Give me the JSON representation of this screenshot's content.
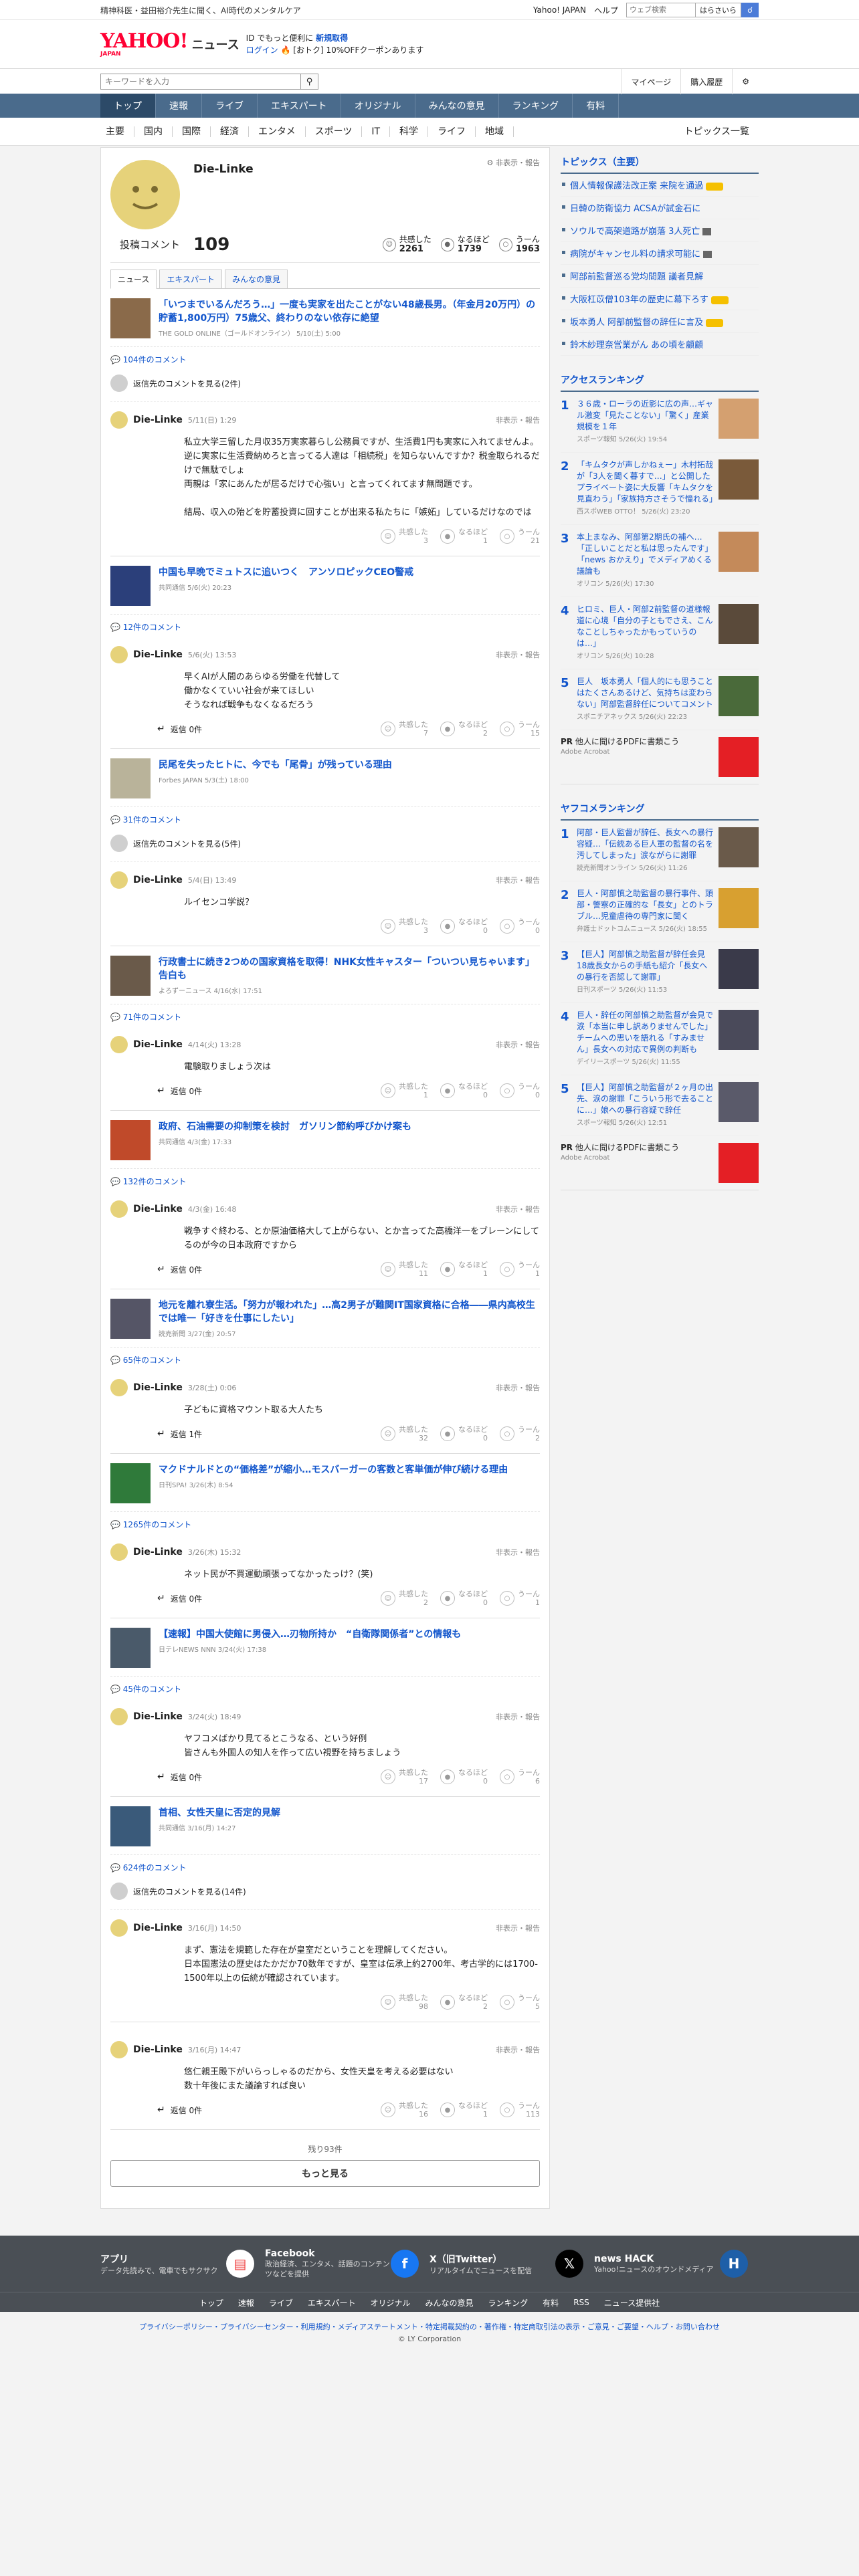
{
  "top": {
    "promo": "精神科医・益田裕介先生に聞く、AI時代のメンタルケア",
    "links": [
      "Yahoo! JAPAN",
      "ヘルプ"
    ],
    "search_placeholder": "ウェブ検索",
    "search_btn": "はらさいら"
  },
  "header": {
    "logo": "YAHOO!",
    "logo_sub": "JAPAN",
    "section": "ニュース",
    "msg1": "ID でもっと便利に",
    "msg1b": "新規取得",
    "login": "ログイン",
    "msg2": "[おトク] 10%OFFクーポンあります"
  },
  "bar2": {
    "kw_placeholder": "キーワードを入力",
    "mypage": "マイページ",
    "history": "購入履歴"
  },
  "gnav": [
    "トップ",
    "速報",
    "ライブ",
    "エキスパート",
    "オリジナル",
    "みんなの意見",
    "ランキング",
    "有料"
  ],
  "snav": [
    "主要",
    "国内",
    "国際",
    "経済",
    "エンタメ",
    "スポーツ",
    "IT",
    "科学",
    "ライフ",
    "地域"
  ],
  "snav_all": "トピックス一覧",
  "profile": {
    "name": "Die-Linke",
    "report": "非表示・報告",
    "label": "投稿コメント",
    "count": "109",
    "rx": [
      {
        "l": "共感した",
        "v": "2261"
      },
      {
        "l": "なるほど",
        "v": "1739"
      },
      {
        "l": "うーん",
        "v": "1963"
      }
    ]
  },
  "tabs": [
    "ニュース",
    "エキスパート",
    "みんなの意見"
  ],
  "items": [
    {
      "title": "「いつまでいるんだろう…」一度も実家を出たことがない48歳長男。（年金月20万円）の貯蓄1,800万円）75歳父、終わりのない依存に絶望",
      "src": "THE GOLD ONLINE（ゴールドオンライン） 5/10(土) 5:00",
      "cc": "104件のコメント",
      "parent": "返信先のコメントを見る(2件)",
      "date": "5/11(日) 1:29",
      "body": "私立大学三留した月収35万実家暮らし公務員ですが、生活費1円も実家に入れてませんよ。\n逆に実家に生活費納めろと言ってる人達は「相続税」を知らないんですか？税金取られるだけで無駄でしょ\n両親は「家にあんたが居るだけで心強い」と言ってくれてます無問題です。\n\n結局、収入の殆どを貯蓄投資に回すことが出来る私たちに「嫉妬」しているだけなのでは",
      "reply": "",
      "r": [
        "3",
        "1",
        "21"
      ],
      "img": "#8a6a4a"
    },
    {
      "title": "中国も早晩でミュトスに追いつく　アンソロピックCEO警戒",
      "src": "共同通信 5/6(火) 20:23",
      "cc": "12件のコメント",
      "parent": "",
      "date": "5/6(火) 13:53",
      "body": "早くAIが人間のあらゆる労働を代替して\n働かなくていい社会が来てほしい\nそうなれば戦争もなくなるだろう",
      "reply": "返信 0件",
      "r": [
        "7",
        "2",
        "15"
      ],
      "img": "#2b3f7a"
    },
    {
      "title": "民尾を失ったヒトに、今でも「尾骨」が残っている理由",
      "src": "Forbes JAPAN 5/3(土) 18:00",
      "cc": "31件のコメント",
      "parent": "返信先のコメントを見る(5件)",
      "date": "5/4(日) 13:49",
      "body": "ルイセンコ学説？",
      "reply": "",
      "r": [
        "3",
        "0",
        "0"
      ],
      "img": "#b9b39a"
    },
    {
      "title": "行政書士に続き2つめの国家資格を取得！NHK女性キャスター「ついつい見ちゃいます」告白も",
      "src": "よろずーニュース 4/16(水) 17:51",
      "cc": "71件のコメント",
      "parent": "",
      "date": "4/14(火) 13:28",
      "body": "電験取りましょう次は",
      "reply": "返信 0件",
      "r": [
        "1",
        "0",
        "0"
      ],
      "img": "#6a5a4a"
    },
    {
      "title": "政府、石油需要の抑制策を検討　ガソリン節約呼びかけ案も",
      "src": "共同通信 4/3(金) 17:33",
      "cc": "132件のコメント",
      "parent": "",
      "date": "4/3(金) 16:48",
      "body": "戦争すぐ終わる、とか原油価格大して上がらない、とか言ってた高橋洋一をブレーンにしてるのが今の日本政府ですから",
      "reply": "返信 0件",
      "r": [
        "11",
        "1",
        "1"
      ],
      "img": "#c04a2a"
    },
    {
      "title": "地元を離れ寮生活。「努力が報われた」…高2男子が難関IT国家資格に合格――県内高校生では唯一「好きを仕事にしたい」",
      "src": "読売新聞 3/27(金) 20:57",
      "cc": "65件のコメント",
      "parent": "",
      "date": "3/28(土) 0:06",
      "body": "子どもに資格マウント取る大人たち",
      "reply": "返信 1件",
      "r": [
        "32",
        "0",
        "2"
      ],
      "img": "#556"
    },
    {
      "title": "マクドナルドとの“価格差”が縮小…モスバーガーの客数と客単価が伸び続ける理由",
      "src": "日刊SPA! 3/26(木) 8:54",
      "cc": "1265件のコメント",
      "parent": "",
      "date": "3/26(木) 15:32",
      "body": "ネット民が不買運動頑張ってなかったっけ？(笑)",
      "reply": "返信 0件",
      "r": [
        "2",
        "0",
        "1"
      ],
      "img": "#2f7a3a"
    },
    {
      "title": "【速報】中国大使館に男侵入…刃物所持か　“自衛隊関係者”との情報も",
      "src": "日テレNEWS NNN 3/24(火) 17:38",
      "cc": "45件のコメント",
      "parent": "",
      "date": "3/24(火) 18:49",
      "body": "ヤフコメばかり見てるとこうなる、という好例\n皆さんも外国人の知人を作って広い視野を持ちましょう",
      "reply": "返信 0件",
      "r": [
        "17",
        "0",
        "6"
      ],
      "img": "#4a5a6a"
    },
    {
      "title": "首相、女性天皇に否定的見解",
      "src": "共同通信 3/16(月) 14:27",
      "cc": "624件のコメント",
      "parent": "返信先のコメントを見る(14件)",
      "date": "3/16(月) 14:50",
      "body": "まず、憲法を規範した存在が皇室だということを理解してください。\n日本国憲法の歴史はたかだか70数年ですが、皇室は伝承上約2700年、考古学的には1700-1500年以上の伝統が確認されています。",
      "reply": "",
      "r": [
        "98",
        "2",
        "5"
      ],
      "img": "#3a5a7a"
    },
    {
      "title": "",
      "src": "",
      "cc": "",
      "parent": "",
      "date": "3/16(月) 14:47",
      "body": "悠仁親王殿下がいらっしゃるのだから、女性天皇を考える必要はない\n数十年後にまた議論すれば良い",
      "reply": "返信 0件",
      "r": [
        "16",
        "1",
        "113"
      ],
      "img": ""
    }
  ],
  "react_labels": [
    "共感した",
    "なるほど",
    "うーん"
  ],
  "remain": "残り93件",
  "more": "もっと見る",
  "topics_h": "トピックス（主要）",
  "topics": [
    {
      "t": "個人情報保護法改正案 来院を通過",
      "b": "new"
    },
    {
      "t": "日韓の防衛協力 ACSAが試金石に",
      "b": ""
    },
    {
      "t": "ソウルで高架道路が崩落 3人死亡",
      "b": "cm"
    },
    {
      "t": "病院がキャンセル料の請求可能に",
      "b": "cm"
    },
    {
      "t": "阿部前監督巡る党均問題 議者見解",
      "b": ""
    },
    {
      "t": "大阪杠苡僧103年の歴史に幕下ろす",
      "b": "new"
    },
    {
      "t": "坂本勇人 阿部前監督の辞任に言及",
      "b": "new"
    },
    {
      "t": "鈴木紗理奈営業がん あの頃を顧顧",
      "b": ""
    }
  ],
  "access_h": "アクセスランキング",
  "access": [
    {
      "n": "1",
      "t": "３６歳・ローラの近影に広の声…ギャル激変「見たことない」「驚く」産業規模を１年",
      "s": "スポーツ報知 5/26(火) 19:54",
      "c": "#d4a070"
    },
    {
      "n": "2",
      "t": "「キムタクが声しかねぇー」木村拓哉が「3人を聞く暮すで…」と公開したプライベート姿に大反響「キムタクを見直わう」「家族持方さそうで憧れる」",
      "s": "西スポWEB OTTO！ 5/26(火) 23:20",
      "c": "#7a5a3a"
    },
    {
      "n": "3",
      "t": "本上まなみ、阿部第2期氏の補へ…「正しいことだと私は思ったんです」「news おかえり」でメディアめくる議論も",
      "s": "オリコン 5/26(火) 17:30",
      "c": "#c48a5a"
    },
    {
      "n": "4",
      "t": "ヒロミ、巨人・阿部2前監督の道様報道に心境「自分の子ともでさえ、こんなことしちゃったかもっていうのは…」",
      "s": "オリコン 5/26(火) 10:28",
      "c": "#5a4a3a"
    },
    {
      "n": "5",
      "t": "巨人　坂本勇人「個人的にも思うことはたくさんあるけど、気持ちは変わらない」阿部監督辞任についてコメント",
      "s": "スポニチアネックス 5/26(火) 22:23",
      "c": "#4a6a3a"
    }
  ],
  "pr": {
    "tag": "PR",
    "title": "他人に聞けるPDFに書類こう",
    "src": "Adobe Acrobat"
  },
  "yc_h": "ヤフコメランキング",
  "yc": [
    {
      "n": "1",
      "t": "阿部・巨人監督が辞任、長女への暴行容疑…「伝統ある巨人軍の監督の名を汚してしまった」涙ながらに謝罪",
      "s": "読売新聞オンライン 5/26(火) 11:26",
      "c": "#6a5a4a"
    },
    {
      "n": "2",
      "t": "巨人・阿部慎之助監督の暴行事件、頭部・警察の正確的な「長女」とのトラブル…児童虐待の専門家に聞く",
      "s": "弁護士ドットコムニュース 5/26(火) 18:55",
      "c": "#d8a030"
    },
    {
      "n": "3",
      "t": "【巨人】阿部慎之助監督が辞任会見　18歳長女からの手紙も紹介「長女への暴行を否認して謝罪」",
      "s": "日刊スポーツ 5/26(火) 11:53",
      "c": "#3a3a4a"
    },
    {
      "n": "4",
      "t": "巨人・辞任の阿部慎之助監督が会見で涙「本当に申し訳ありませんでした」チームへの思いを語れる「すみません」長女への対応で異例の判断も",
      "s": "デイリースポーツ 5/26(火) 11:55",
      "c": "#4a4a5a"
    },
    {
      "n": "5",
      "t": "【巨人】阿部慎之助監督が２ヶ月の出先、涙の謝罪「こういう形で去ることに…」娘への暴行容疑で辞任",
      "s": "スポーツ報知 5/26(火) 12:51",
      "c": "#5a5a6a"
    }
  ],
  "footer": {
    "cols": [
      {
        "t": "アプリ",
        "d": "データ先読みで、電車でもサクサク",
        "i": "app"
      },
      {
        "t": "Facebook",
        "d": "政治経済、エンタメ、話題のコンテンツなどを提供",
        "i": "f"
      },
      {
        "t": "X（旧Twitter）",
        "d": "リアルタイムでニュースを配信",
        "i": "X"
      },
      {
        "t": "news HACK",
        "d": "Yahoo!ニュースのオウンドメディア",
        "i": "HACK"
      }
    ],
    "nav": [
      "トップ",
      "速報",
      "ライブ",
      "エキスパート",
      "オリジナル",
      "みんなの意見",
      "ランキング",
      "有料",
      "RSS",
      "ニュース提供社"
    ],
    "links": "プライバシーポリシー・プライバシーセンター・利用規約・メディアステートメント・特定掲載契約の・著作権・特定商取引法の表示・ご意見・ご要望・ヘルプ・お問い合わせ",
    "copy": "© LY Corporation"
  },
  "colors": {
    "accent": "#1155cc",
    "nav": "#4a6b8c",
    "brand": "#ff0033"
  }
}
